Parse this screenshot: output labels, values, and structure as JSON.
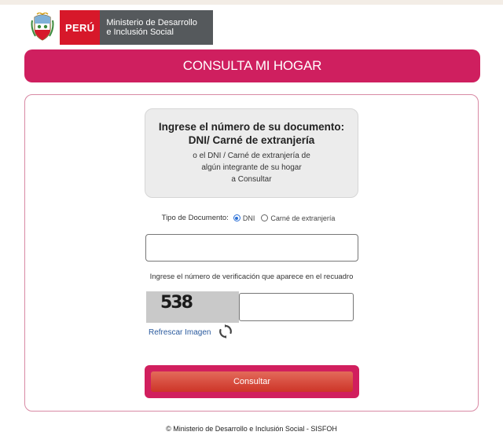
{
  "header": {
    "logo_country": "PERÚ",
    "logo_ministry_line1": "Ministerio de Desarrollo",
    "logo_ministry_line2": "e Inclusión Social"
  },
  "banner": {
    "title": "CONSULTA MI HOGAR"
  },
  "info_box": {
    "title_line1": "Ingrese el número de su documento:",
    "title_line2": "DNI/ Carné de extranjería",
    "desc_line1": "o el DNI / Carné de extranjería de",
    "desc_line2": "algún integrante de su hogar",
    "desc_line3": "a Consultar"
  },
  "document_type": {
    "label": "Tipo de Documento:",
    "options": [
      {
        "label": "DNI",
        "selected": true
      },
      {
        "label": "Carné de extranjería",
        "selected": false
      }
    ]
  },
  "document_input": {
    "value": "",
    "placeholder": ""
  },
  "verification": {
    "label": "Ingrese el número de verificación que aparece en el recuadro",
    "captcha_text": "538",
    "input_value": "",
    "refresh_label": "Refrescar Imagen"
  },
  "submit": {
    "label": "Consultar"
  },
  "footer": {
    "text": "© Ministerio de Desarrollo e Inclusión Social - SISFOH"
  },
  "colors": {
    "accent": "#cf1f5f",
    "peru_red": "#d7182a",
    "ministry_gray": "#55595c",
    "button_red": "#cd3528",
    "link_blue": "#2a5a9e"
  },
  "icons": [
    "coat-of-arms-icon",
    "refresh-icon"
  ]
}
